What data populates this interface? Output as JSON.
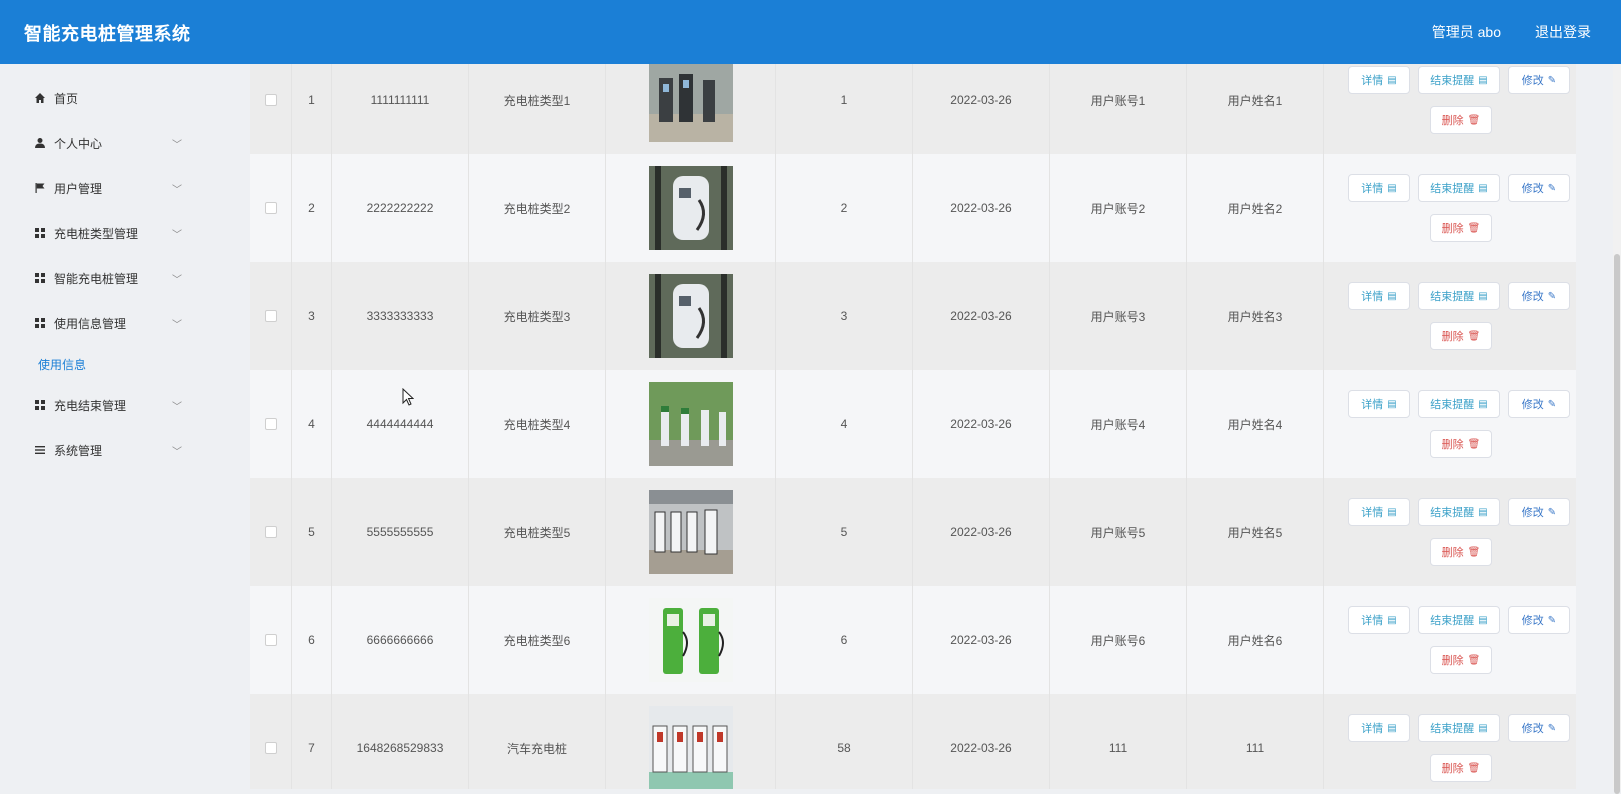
{
  "header": {
    "title": "智能充电桩管理系统",
    "user": "管理员 abo",
    "logout": "退出登录"
  },
  "sidebar": {
    "items": [
      {
        "label": "首页",
        "icon": "home-icon",
        "expandable": false
      },
      {
        "label": "个人中心",
        "icon": "user-icon",
        "expandable": true
      },
      {
        "label": "用户管理",
        "icon": "flag-icon",
        "expandable": true
      },
      {
        "label": "充电桩类型管理",
        "icon": "grid-icon",
        "expandable": true
      },
      {
        "label": "智能充电桩管理",
        "icon": "grid-icon",
        "expandable": true
      },
      {
        "label": "使用信息管理",
        "icon": "grid-icon",
        "expandable": true
      },
      {
        "label": "充电结束管理",
        "icon": "grid-icon",
        "expandable": true
      },
      {
        "label": "系统管理",
        "icon": "list-icon",
        "expandable": true
      }
    ],
    "sub_item": "使用信息"
  },
  "table": {
    "buttons": {
      "detail": "详情",
      "end": "结束提醒",
      "edit": "修改",
      "delete": "删除"
    },
    "rows": [
      {
        "index": "1",
        "code": "1111111111",
        "type": "充电桩类型1",
        "qty": "1",
        "date": "2022-03-26",
        "account": "用户账号1",
        "name": "用户姓名1",
        "image": "charging-station-outdoor"
      },
      {
        "index": "2",
        "code": "2222222222",
        "type": "充电桩类型2",
        "qty": "2",
        "date": "2022-03-26",
        "account": "用户账号2",
        "name": "用户姓名2",
        "image": "charging-station-white"
      },
      {
        "index": "3",
        "code": "3333333333",
        "type": "充电桩类型3",
        "qty": "3",
        "date": "2022-03-26",
        "account": "用户账号3",
        "name": "用户姓名3",
        "image": "charging-station-white"
      },
      {
        "index": "4",
        "code": "4444444444",
        "type": "充电桩类型4",
        "qty": "4",
        "date": "2022-03-26",
        "account": "用户账号4",
        "name": "用户姓名4",
        "image": "charging-station-garden"
      },
      {
        "index": "5",
        "code": "5555555555",
        "type": "充电桩类型5",
        "qty": "5",
        "date": "2022-03-26",
        "account": "用户账号5",
        "name": "用户姓名5",
        "image": "charging-station-row"
      },
      {
        "index": "6",
        "code": "6666666666",
        "type": "充电桩类型6",
        "qty": "6",
        "date": "2022-03-26",
        "account": "用户账号6",
        "name": "用户姓名6",
        "image": "charging-station-green"
      },
      {
        "index": "7",
        "code": "1648268529833",
        "type": "汽车充电桩",
        "qty": "58",
        "date": "2022-03-26",
        "account": "111",
        "name": "111",
        "image": "charging-station-indoor"
      }
    ]
  },
  "colors": {
    "header": "#1b7fd6",
    "sidebar": "#eef0f3",
    "link": "#1b7fd6",
    "danger": "#d9534f",
    "info": "#3aa0c8"
  }
}
